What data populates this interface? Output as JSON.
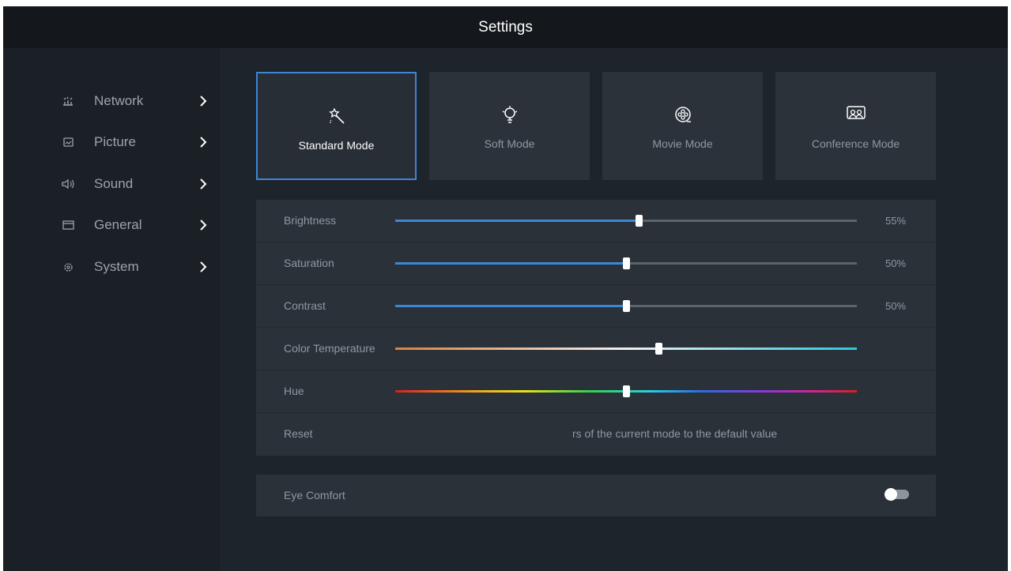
{
  "header": {
    "title": "Settings"
  },
  "sidebar": {
    "items": [
      {
        "label": "Network",
        "icon": "network-icon"
      },
      {
        "label": "Picture",
        "icon": "picture-icon"
      },
      {
        "label": "Sound",
        "icon": "sound-icon"
      },
      {
        "label": "General",
        "icon": "general-icon"
      },
      {
        "label": "System",
        "icon": "system-icon"
      }
    ]
  },
  "modes": [
    {
      "label": "Standard Mode",
      "icon": "magic-wand-icon",
      "selected": true
    },
    {
      "label": "Soft Mode",
      "icon": "lightbulb-icon",
      "selected": false
    },
    {
      "label": "Movie Mode",
      "icon": "film-reel-icon",
      "selected": false
    },
    {
      "label": "Conference Mode",
      "icon": "conference-icon",
      "selected": false
    }
  ],
  "picture": {
    "brightness": {
      "label": "Brightness",
      "value": "55%",
      "level": 0.527
    },
    "saturation": {
      "label": "Saturation",
      "value": "50%",
      "level": 0.5
    },
    "contrast": {
      "label": "Contrast",
      "value": "50%",
      "level": 0.5
    },
    "color_temperature": {
      "label": "Color Temperature",
      "level": 0.57
    },
    "hue": {
      "label": "Hue",
      "level": 0.5
    },
    "reset": {
      "label": "Reset",
      "description": "rs of the current mode to the default value"
    }
  },
  "eye_comfort": {
    "label": "Eye Comfort",
    "enabled": false
  },
  "colors": {
    "accent": "#3d86d6",
    "background": "#1e242b",
    "panel": "#2a3139"
  }
}
